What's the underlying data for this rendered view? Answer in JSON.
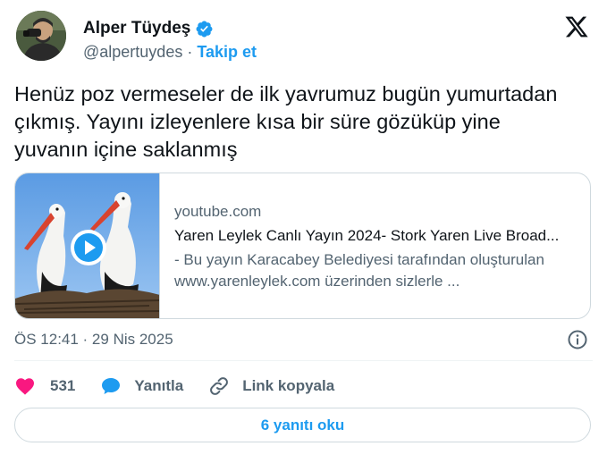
{
  "author": {
    "display_name": "Alper Tüydeş",
    "handle": "@alpertuydes",
    "separator": "·",
    "follow_label": "Takip et",
    "avatar_icon": "person-with-binoculars",
    "verified_icon": "verified-badge-icon"
  },
  "tweet": {
    "text_lines": [
      "Henüz poz vermeseler de ilk yavrumuz bugün yumurtadan",
      "çıkmış. Yayını izleyenlere kısa bir süre gözüküp yine",
      "yuvanın içine saklanmış"
    ]
  },
  "card": {
    "domain": "youtube.com",
    "title": "Yaren Leylek Canlı Yayın 2024- Stork Yaren Live Broad...",
    "description_lines": [
      "- Bu yayın Karacabey Belediyesi tarafından oluşturulan",
      "www.yarenleylek.com üzerinden sizlerle ..."
    ],
    "thumbnail_icon": "storks-video-thumbnail",
    "play_icon": "play-icon"
  },
  "meta": {
    "timestamp": "ÖS 12:41 · 29 Nis 2025",
    "info_icon": "info-icon"
  },
  "actions": {
    "like_count": "531",
    "reply_label": "Yanıtla",
    "copy_link_label": "Link kopyala"
  },
  "replies_button": {
    "label": "6 yanıtı oku"
  },
  "colors": {
    "accent": "#1d9bf0",
    "like": "#f91880",
    "text": "#0f1419",
    "secondary": "#536471",
    "border": "#cfd9de"
  }
}
